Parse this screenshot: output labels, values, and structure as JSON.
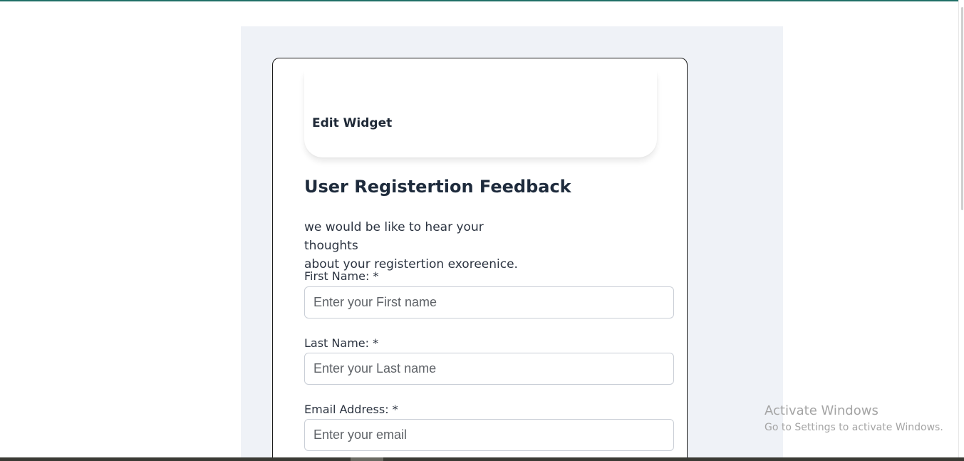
{
  "widget": {
    "edit_label": "Edit Widget"
  },
  "form": {
    "title": "User Registertion Feedback",
    "description_line1": "we would be like to hear your thoughts",
    "description_line2": "about your registertion exoreenice.",
    "fields": [
      {
        "label": "First Name: *",
        "placeholder": "Enter your First name",
        "value": ""
      },
      {
        "label": "Last Name: *",
        "placeholder": "Enter your Last name",
        "value": ""
      },
      {
        "label": "Email Address: *",
        "placeholder": "Enter your email",
        "value": ""
      }
    ]
  },
  "os_watermark": {
    "title": "Activate Windows",
    "subtitle": "Go to Settings to activate Windows."
  },
  "colors": {
    "accent_top_bar": "#1f6f66",
    "panel_background": "#eff2f7",
    "title_text": "#1e2b3c"
  }
}
